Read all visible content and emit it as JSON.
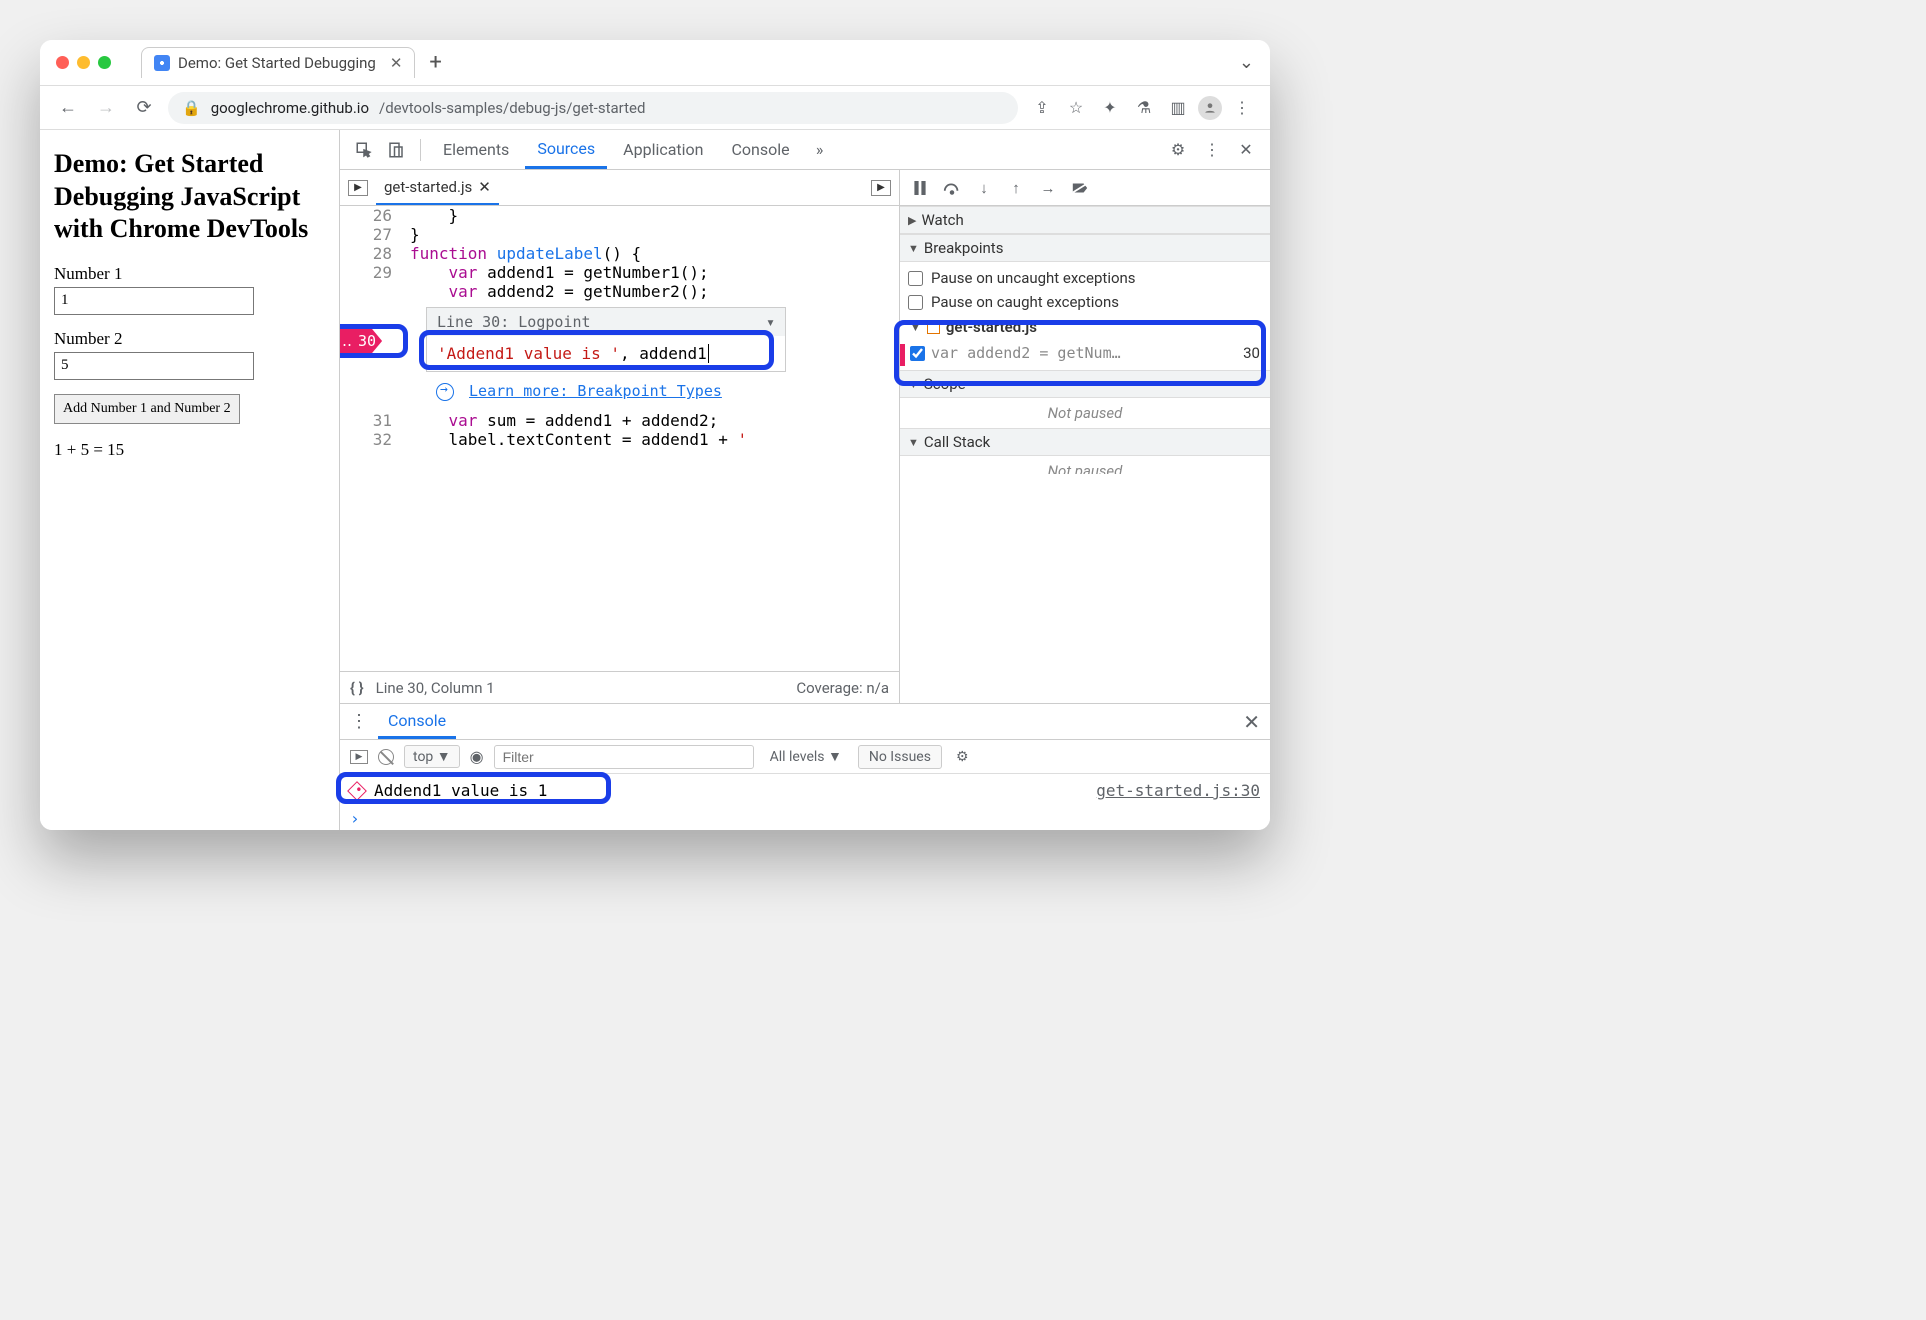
{
  "browser": {
    "tab_title": "Demo: Get Started Debugging",
    "url_host": "googlechrome.github.io",
    "url_path": "/devtools-samples/debug-js/get-started"
  },
  "page": {
    "heading": "Demo: Get Started Debugging JavaScript with Chrome DevTools",
    "labels": {
      "n1": "Number 1",
      "n2": "Number 2"
    },
    "values": {
      "n1": "1",
      "n2": "5"
    },
    "button": "Add Number 1 and Number 2",
    "result": "1 + 5 = 15"
  },
  "devtools": {
    "tabs": {
      "elements": "Elements",
      "sources": "Sources",
      "application": "Application",
      "console": "Console"
    },
    "file_tab": "get-started.js",
    "code": {
      "lines": {
        "l26": "26",
        "l27": "27",
        "l28": "28",
        "l29": "29",
        "l30": "30",
        "l31": "31",
        "l32": "32"
      },
      "t26": "    }",
      "t27": "}",
      "t28_fn": "function",
      "t28_name": " updateLabel",
      "t28_end": "() {",
      "t29_var": "    var",
      "t29_rest": " addend1 = getNumber1();",
      "t30_var": "    var",
      "t30_rest": " addend2 = getNumber2();",
      "t31_var": "    var",
      "t31_rest": " sum = addend1 + addend2;",
      "t32a": "    label.textContent = addend1 + ",
      "t32b": "' "
    },
    "logpoint_flag": "30",
    "logpoint": {
      "header": "Line 30:   Logpoint",
      "expr_str": "'Addend1 value is '",
      "expr_rest": ", addend1"
    },
    "learn_more": "Learn more: Breakpoint Types",
    "status": {
      "pos": "Line 30, Column 1",
      "coverage": "Coverage: n/a"
    }
  },
  "sidebar": {
    "watch": "Watch",
    "breakpoints": "Breakpoints",
    "bp_uncaught": "Pause on uncaught exceptions",
    "bp_caught": "Pause on caught exceptions",
    "bp_file": "get-started.js",
    "bp_item_code": "var addend2 = getNum…",
    "bp_item_line": "30",
    "scope": "Scope",
    "not_paused": "Not paused",
    "callstack": "Call Stack",
    "not_paused2": "Not paused"
  },
  "drawer": {
    "console_tab": "Console",
    "top": "top",
    "filter_placeholder": "Filter",
    "levels": "All levels",
    "no_issues": "No Issues",
    "log_msg": "Addend1 value is  1",
    "log_src": "get-started.js:30"
  }
}
